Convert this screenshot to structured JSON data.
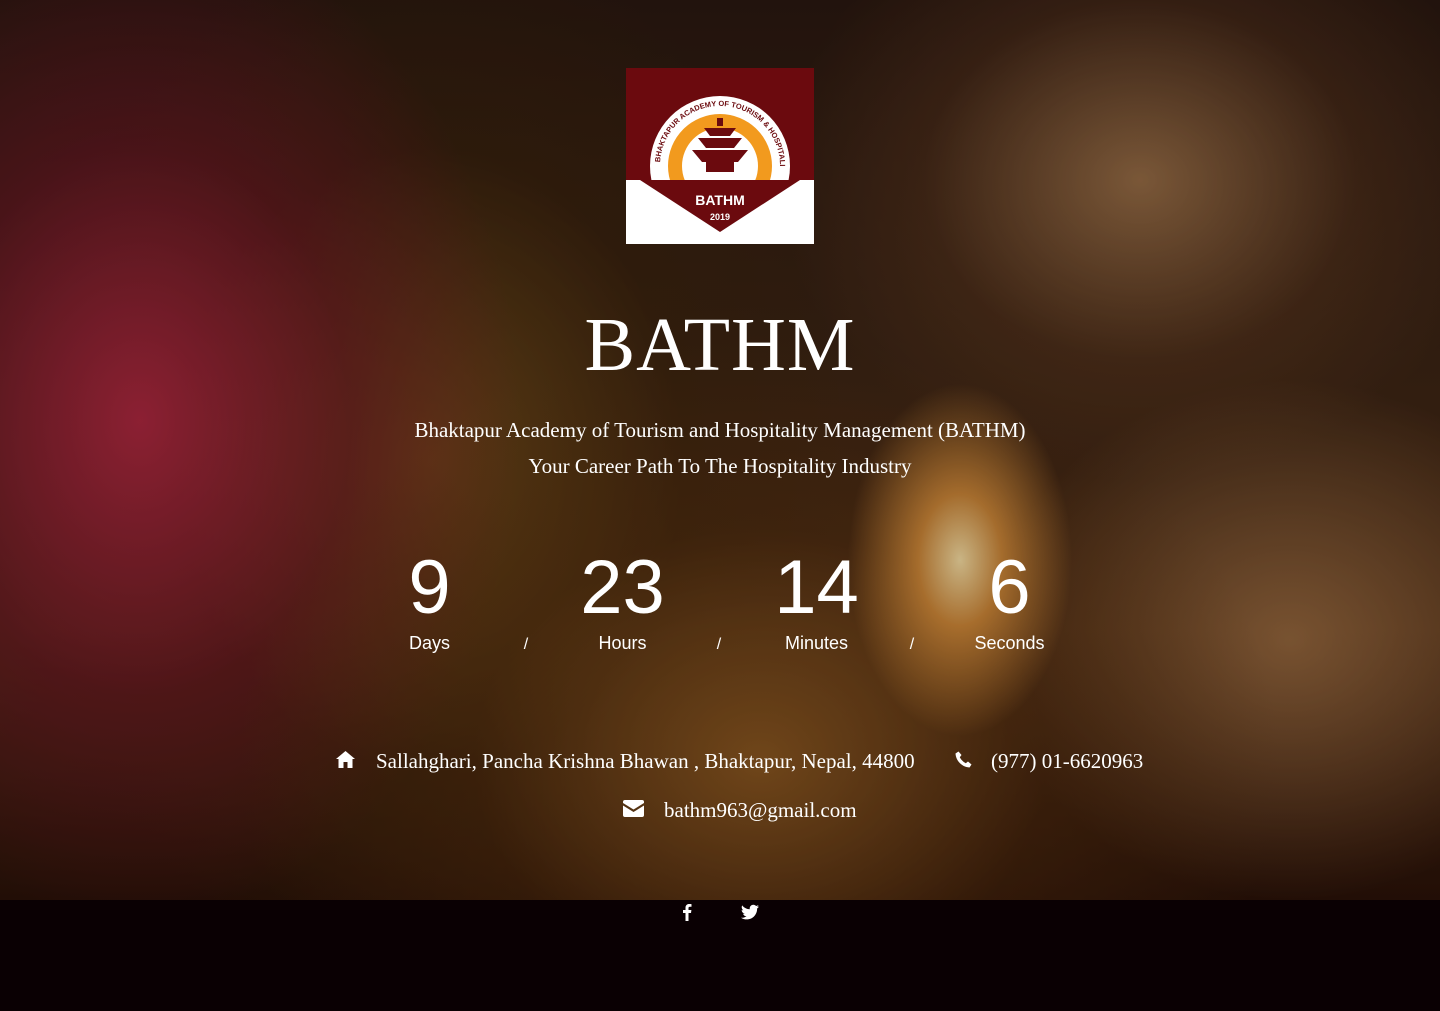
{
  "logo": {
    "ring_text": "BHAKTAPUR ACADEMY OF TOURISM & HOSPITALITY MANAGEMENT",
    "name": "BATHM",
    "year": "2019",
    "colors": {
      "maroon": "#6b0a0e",
      "orange": "#f29a1e",
      "white": "#ffffff"
    }
  },
  "header": {
    "title": "BATHM",
    "subtitle_line1": "Bhaktapur Academy of Tourism and Hospitality Management (BATHM)",
    "subtitle_line2": "Your Career Path To The Hospitality Industry"
  },
  "countdown": {
    "units": [
      {
        "value": "9",
        "label": "Days"
      },
      {
        "value": "23",
        "label": "Hours"
      },
      {
        "value": "14",
        "label": "Minutes"
      },
      {
        "value": "6",
        "label": "Seconds"
      }
    ],
    "separator": "/"
  },
  "contact": {
    "address_icon": "home-icon",
    "address": "Sallahghari, Pancha Krishna Bhawan , Bhaktapur, Nepal, 44800",
    "phone_icon": "phone-icon",
    "phone": "(977) 01-6620963",
    "email_icon": "envelope-icon",
    "email": "bathm963@gmail.com"
  },
  "social": {
    "facebook_icon": "facebook-icon",
    "twitter_icon": "twitter-icon"
  }
}
